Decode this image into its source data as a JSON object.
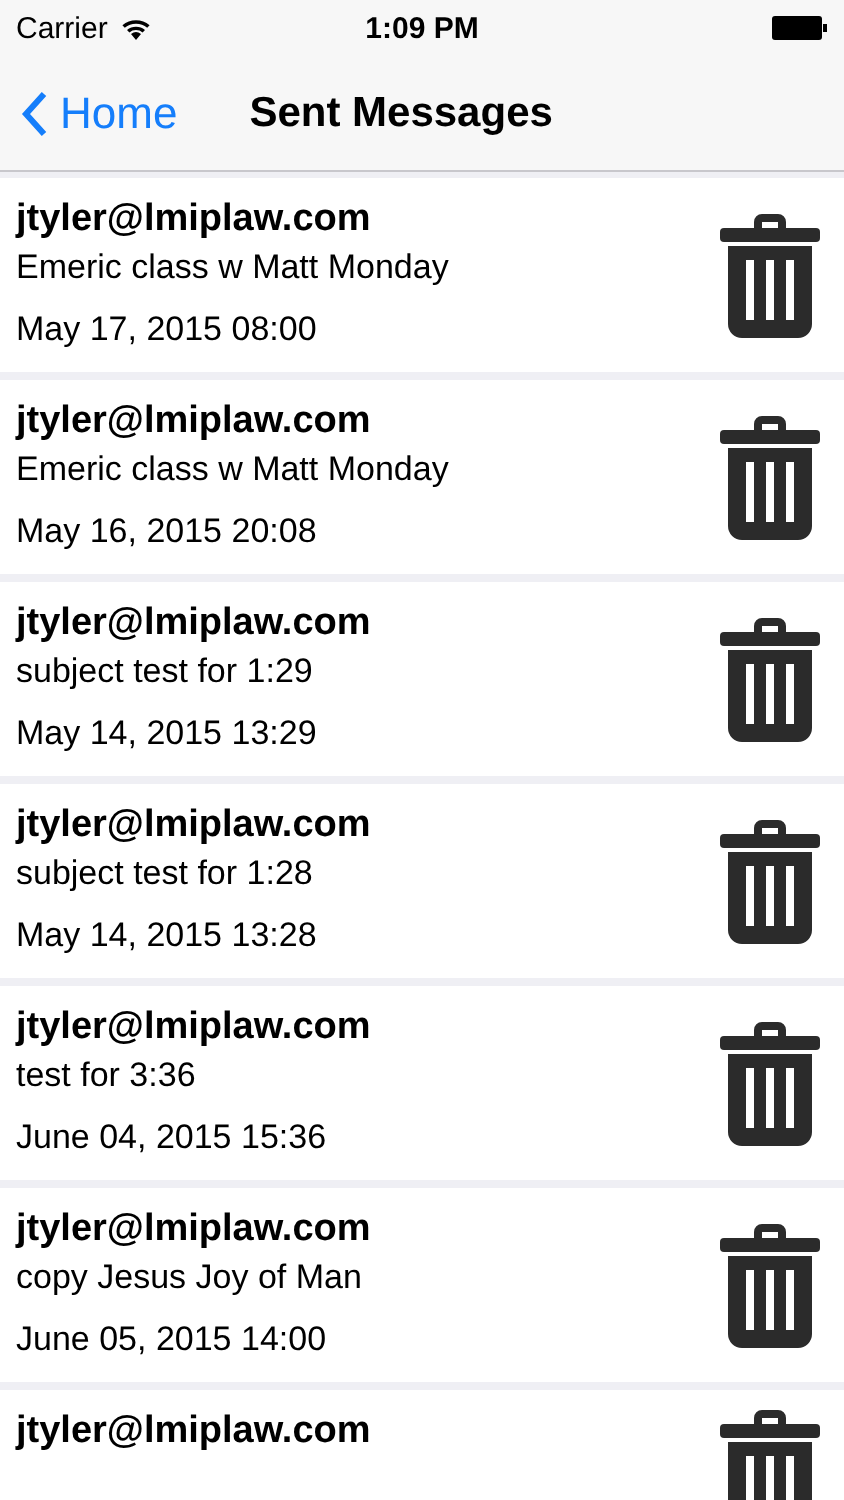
{
  "status_bar": {
    "carrier": "Carrier",
    "time": "1:09 PM"
  },
  "nav_bar": {
    "back_label": "Home",
    "title": "Sent Messages"
  },
  "messages": [
    {
      "sender": "jtyler@lmiplaw.com",
      "subject": "Emeric class w Matt Monday",
      "date": "May 17, 2015 08:00"
    },
    {
      "sender": "jtyler@lmiplaw.com",
      "subject": "Emeric class w Matt Monday",
      "date": "May 16, 2015 20:08"
    },
    {
      "sender": "jtyler@lmiplaw.com",
      "subject": "subject test for 1:29",
      "date": "May 14, 2015 13:29"
    },
    {
      "sender": "jtyler@lmiplaw.com",
      "subject": "subject test for 1:28",
      "date": "May 14, 2015 13:28"
    },
    {
      "sender": "jtyler@lmiplaw.com",
      "subject": "test for 3:36",
      "date": "June 04, 2015 15:36"
    },
    {
      "sender": "jtyler@lmiplaw.com",
      "subject": "copy Jesus Joy of Man",
      "date": "June 05, 2015 14:00"
    },
    {
      "sender": "jtyler@lmiplaw.com"
    }
  ]
}
